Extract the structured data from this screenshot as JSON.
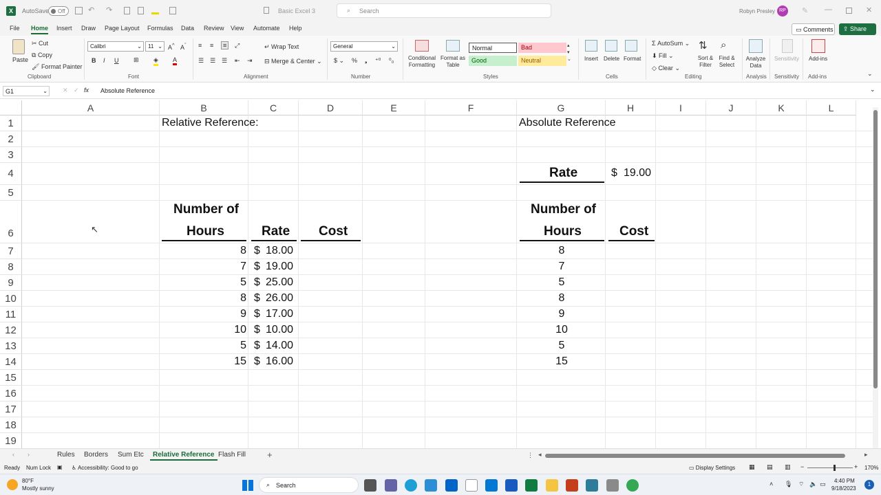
{
  "title_bar": {
    "autosave_label": "AutoSave",
    "autosave_state": "Off",
    "file_name": "Basic Excel 3",
    "search_placeholder": "Search",
    "user_name": "Robyn Presley",
    "user_initials": "RP"
  },
  "menu": [
    "File",
    "Home",
    "Insert",
    "Draw",
    "Page Layout",
    "Formulas",
    "Data",
    "Review",
    "View",
    "Automate",
    "Help"
  ],
  "menu_active": "Home",
  "comments_label": "Comments",
  "share_label": "Share",
  "ribbon": {
    "clipboard": {
      "paste": "Paste",
      "cut": "Cut",
      "copy": "Copy",
      "format_painter": "Format Painter",
      "label": "Clipboard"
    },
    "font": {
      "name": "Calibri",
      "size": "11",
      "label": "Font"
    },
    "alignment": {
      "wrap": "Wrap Text",
      "merge": "Merge & Center",
      "label": "Alignment"
    },
    "number": {
      "format": "General",
      "label": "Number"
    },
    "styles": {
      "conditional": "Conditional Formatting",
      "format_table": "Format as Table",
      "normal": "Normal",
      "bad": "Bad",
      "good": "Good",
      "neutral": "Neutral",
      "label": "Styles"
    },
    "cells": {
      "insert": "Insert",
      "delete": "Delete",
      "format": "Format",
      "label": "Cells"
    },
    "editing": {
      "autosum": "AutoSum",
      "fill": "Fill",
      "clear": "Clear",
      "sort": "Sort & Filter",
      "find": "Find & Select",
      "label": "Editing"
    },
    "analysis": {
      "analyze": "Analyze Data",
      "label": "Analysis"
    },
    "sensitivity": {
      "btn": "Sensitivity",
      "label": "Sensitivity"
    },
    "addins": {
      "btn": "Add-ins",
      "label": "Add-ins"
    }
  },
  "formula_bar": {
    "name_box": "G1",
    "fx": "fx",
    "content": "Absolute Reference"
  },
  "columns": [
    "A",
    "B",
    "C",
    "D",
    "E",
    "F",
    "G",
    "H",
    "I",
    "J",
    "K",
    "L"
  ],
  "rows": [
    "1",
    "2",
    "3",
    "4",
    "5",
    "6",
    "7",
    "8",
    "9",
    "10",
    "11",
    "12",
    "13",
    "14",
    "15",
    "16",
    "17",
    "18",
    "19"
  ],
  "sheet": {
    "b1": "Relative Reference:",
    "g1": "Absolute Reference",
    "g4": "Rate",
    "h4_cur": "$",
    "h4_val": "19.00",
    "hdr_hours_1": "Number of",
    "hdr_hours_2": "Hours",
    "hdr_rate": "Rate",
    "hdr_cost": "Cost",
    "hours": [
      "8",
      "7",
      "5",
      "8",
      "9",
      "10",
      "5",
      "15"
    ],
    "rate_cur": "$",
    "rates": [
      "18.00",
      "19.00",
      "25.00",
      "26.00",
      "17.00",
      "10.00",
      "14.00",
      "16.00"
    ]
  },
  "sheet_tabs": [
    "Rules",
    "Borders",
    "Sum Etc",
    "Relative Reference",
    "Flash Fill"
  ],
  "sheet_tab_active": "Relative Reference",
  "status": {
    "ready": "Ready",
    "numlock": "Num Lock",
    "accessibility": "Accessibility: Good to go",
    "display": "Display Settings",
    "zoom": "170%"
  },
  "taskbar": {
    "temp": "80°F",
    "weather": "Mostly sunny",
    "search": "Search",
    "time": "4:40 PM",
    "date": "9/18/2023",
    "notif": "1"
  }
}
